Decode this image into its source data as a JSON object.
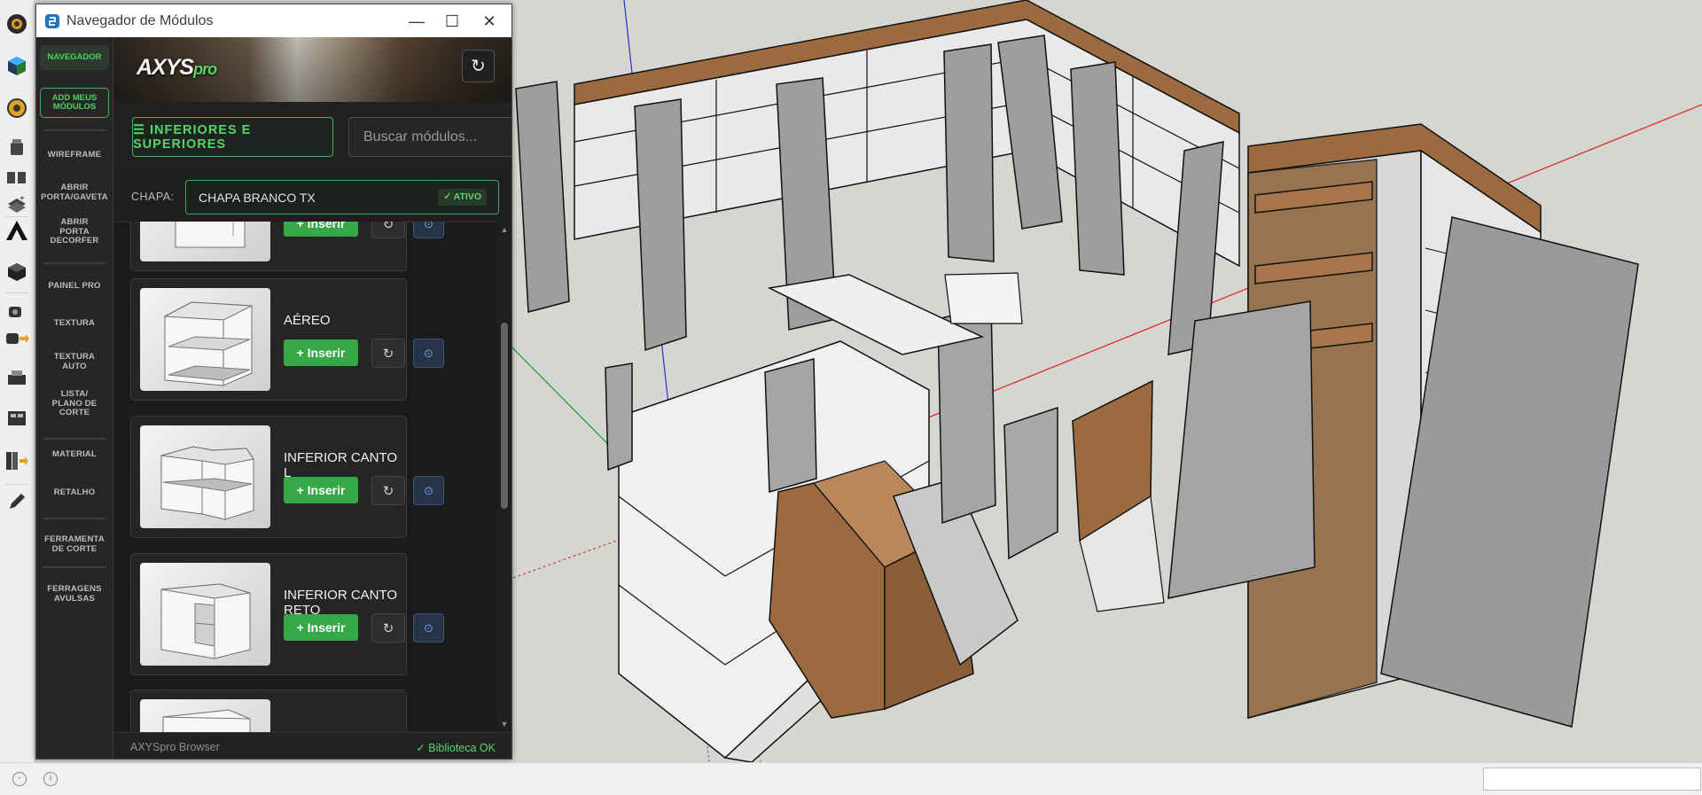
{
  "window": {
    "title": "Navegador de Módulos",
    "minimize_glyph": "—",
    "maximize_glyph": "☐",
    "close_glyph": "✕"
  },
  "brand": {
    "logo_main": "AXYS",
    "logo_accent": "pro"
  },
  "nav": {
    "active_item": "NAVEGADOR",
    "add_my_modules_line1": "ADD MEUS",
    "add_my_modules_line2": "MÓDULOS",
    "items": [
      "WIREFRAME",
      "ABRIR PORTA/GAVETA",
      "ABRIR PORTA DECORFER",
      "PAINEL PRO",
      "TEXTURA",
      "TEXTURA AUTO",
      "LISTA/ PLANO DE CORTE",
      "MATERIAL",
      "RETALHO",
      "FERRAMENTA DE CORTE",
      "FERRAGENS AVULSAS"
    ]
  },
  "filters": {
    "category_label": "☰ INFERIORES E SUPERIORES",
    "search_placeholder": "Buscar módulos..."
  },
  "chapa": {
    "label": "CHAPA:",
    "value": "CHAPA BRANCO TX",
    "status": "✓ ATIVO"
  },
  "modules": [
    {
      "name": "",
      "insert_label": "+ Inserir"
    },
    {
      "name": "AÉREO",
      "insert_label": "+ Inserir"
    },
    {
      "name": "INFERIOR CANTO L",
      "insert_label": "+ Inserir"
    },
    {
      "name": "INFERIOR CANTO RETO",
      "insert_label": "+ Inserir"
    },
    {
      "name": "",
      "insert_label": ""
    }
  ],
  "footer": {
    "left": "AXYSpro Browser",
    "right": "✓ Biblioteca OK"
  },
  "icons": {
    "rotate": "↻",
    "info": "⊙",
    "refresh": "↻"
  },
  "colors": {
    "accent_green": "#4cd25e",
    "panel_bg": "#1b1b1b",
    "wood": "#9b6a3e",
    "carcass_gray": "#9a9a9a",
    "axis_red": "#d22",
    "axis_green": "#1a9a1a",
    "axis_blue": "#2233cc"
  }
}
